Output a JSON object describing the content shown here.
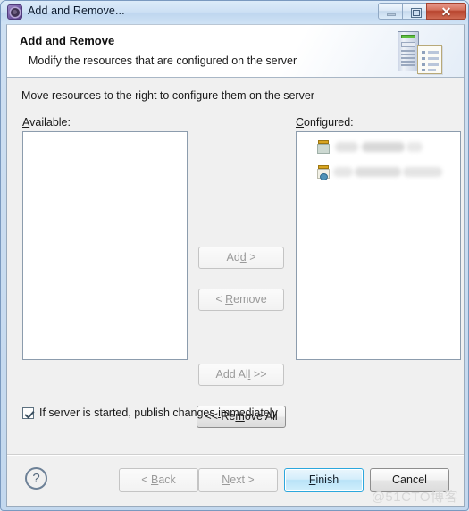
{
  "window": {
    "title": "Add and Remove...",
    "icon": "server-gear-icon",
    "controls": {
      "minimize": "minimize-icon",
      "maximize": "maximize-icon",
      "close": "✕"
    }
  },
  "header": {
    "title": "Add and Remove",
    "subtitle": "Modify the resources that are configured on the server",
    "icon": "server-document-icon"
  },
  "main": {
    "instruction": "Move resources to the right to configure them on the server",
    "available_label_pre": "A",
    "available_label_post": "vailable:",
    "configured_label_pre": "C",
    "configured_label_post": "onfigured:",
    "available_items": [],
    "configured_items": [
      {
        "icon": "web-module-icon",
        "label": ""
      },
      {
        "icon": "web-module-globe-icon",
        "label": ""
      }
    ]
  },
  "transfer_buttons": {
    "add": {
      "pre": "Ad",
      "mn": "d",
      "post": " >",
      "enabled": false
    },
    "remove": {
      "pre": "< ",
      "mn": "R",
      "post": "emove",
      "enabled": false
    },
    "add_all": {
      "pre": "Add Al",
      "mn": "l",
      "post": " >>",
      "enabled": false
    },
    "remove_all": {
      "pre": "<< Re",
      "mn": "m",
      "post": "ove All",
      "enabled": true
    }
  },
  "checkbox": {
    "checked": true,
    "label_pre": "If server is started, publish changes ",
    "label_mn": "i",
    "label_post": "mmediately"
  },
  "footer": {
    "help": "?",
    "back": {
      "pre": "< ",
      "mn": "B",
      "post": "ack",
      "enabled": false
    },
    "next": {
      "pre": "",
      "mn": "N",
      "post": "ext >",
      "enabled": false
    },
    "finish": {
      "pre": "",
      "mn": "F",
      "post": "inish",
      "enabled": true,
      "default": true
    },
    "cancel": {
      "pre": "",
      "mn": "",
      "post": "Cancel",
      "enabled": true
    }
  },
  "watermark": "@51CTO博客",
  "colors": {
    "accent": "#2ca7dd",
    "titlebar": "#cde0f4",
    "body": "#f0f0f0",
    "close_button": "#b8452f",
    "led_green": "#5fbf3f"
  }
}
